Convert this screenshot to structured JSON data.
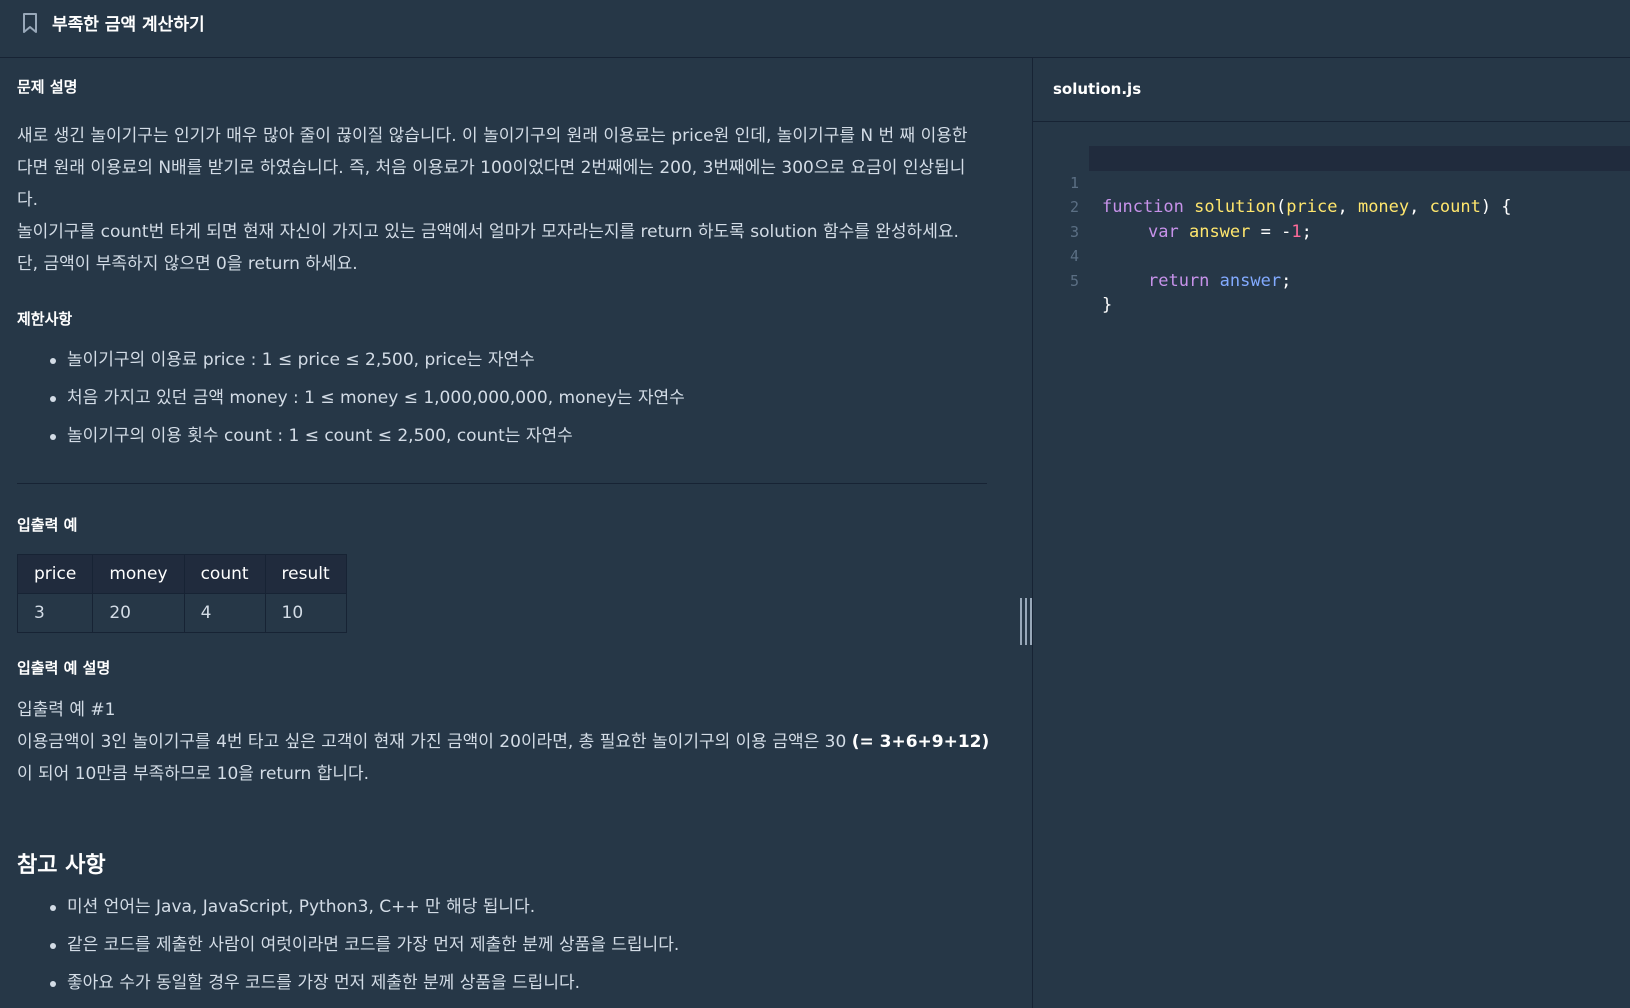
{
  "header": {
    "title": "부족한 금액 계산하기",
    "bookmark_icon": "bookmark-icon"
  },
  "problem": {
    "heading": "문제 설명",
    "lines": [
      "새로 생긴 놀이기구는 인기가 매우 많아 줄이 끊이질 않습니다. 이 놀이기구의 원래 이용료는 price원 인데, 놀이기구를 N 번 째 이용한",
      "다면 원래 이용료의 N배를 받기로 하였습니다. 즉, 처음 이용료가 100이었다면 2번째에는 200, 3번째에는 300으로 요금이 인상됩니",
      "다.",
      "놀이기구를 count번 타게 되면 현재 자신이 가지고 있는 금액에서 얼마가 모자라는지를 return 하도록 solution 함수를 완성하세요.",
      "단, 금액이 부족하지 않으면 0을 return 하세요."
    ]
  },
  "constraints": {
    "heading": "제한사항",
    "items": [
      "놀이기구의 이용료 price : 1 ≤ price ≤ 2,500, price는 자연수",
      "처음 가지고 있던 금액 money : 1 ≤ money ≤ 1,000,000,000, money는 자연수",
      "놀이기구의 이용 횟수 count : 1 ≤ count ≤ 2,500, count는 자연수"
    ]
  },
  "io_example": {
    "heading": "입출력 예",
    "columns": [
      "price",
      "money",
      "count",
      "result"
    ],
    "rows": [
      [
        "3",
        "20",
        "4",
        "10"
      ]
    ]
  },
  "io_explanation": {
    "heading": "입출력 예 설명",
    "subheading": "입출력 예 #1",
    "line1_prefix": "이용금액이 3인 놀이기구를 4번 타고 싶은 고객이 현재 가진 금액이 20이라면, 총 필요한 놀이기구의 이용 금액은 30 ",
    "line1_bold": "(= 3+6+9+12)",
    "line2": "이 되어 10만큼 부족하므로 10을 return 합니다."
  },
  "references": {
    "heading": "참고 사항",
    "items": [
      "미션 언어는 Java, JavaScript, Python3, C++ 만 해당 됩니다.",
      "같은 코드를 제출한 사람이 여럿이라면 코드를 가장 먼저 제출한 분께 상품을 드립니다.",
      "좋아요 수가 동일할 경우 코드를 가장 먼저 제출한 분께 상품을 드립니다."
    ]
  },
  "editor": {
    "filename": "solution.js",
    "line_numbers": [
      "1",
      "2",
      "3",
      "4",
      "5"
    ],
    "code": {
      "l1_kw": "function",
      "l1_fn": "solution",
      "l1_open": "(",
      "l1_p1": "price",
      "l1_sep1": ", ",
      "l1_p2": "money",
      "l1_sep2": ", ",
      "l1_p3": "count",
      "l1_close": ") {",
      "l2_kw": "var",
      "l2_var": "answer",
      "l2_op": " = -",
      "l2_num": "1",
      "l2_end": ";",
      "l4_kw": "return",
      "l4_ident": "answer",
      "l4_end": ";",
      "l5": "}"
    }
  },
  "colors": {
    "background": "#263747",
    "border": "#172334",
    "table_header_bg": "#202b3d",
    "text": "#d3dce6",
    "keyword": "#c792ea",
    "function": "#ffe66d",
    "number": "#ff6b9a",
    "identifier": "#82aaff"
  }
}
